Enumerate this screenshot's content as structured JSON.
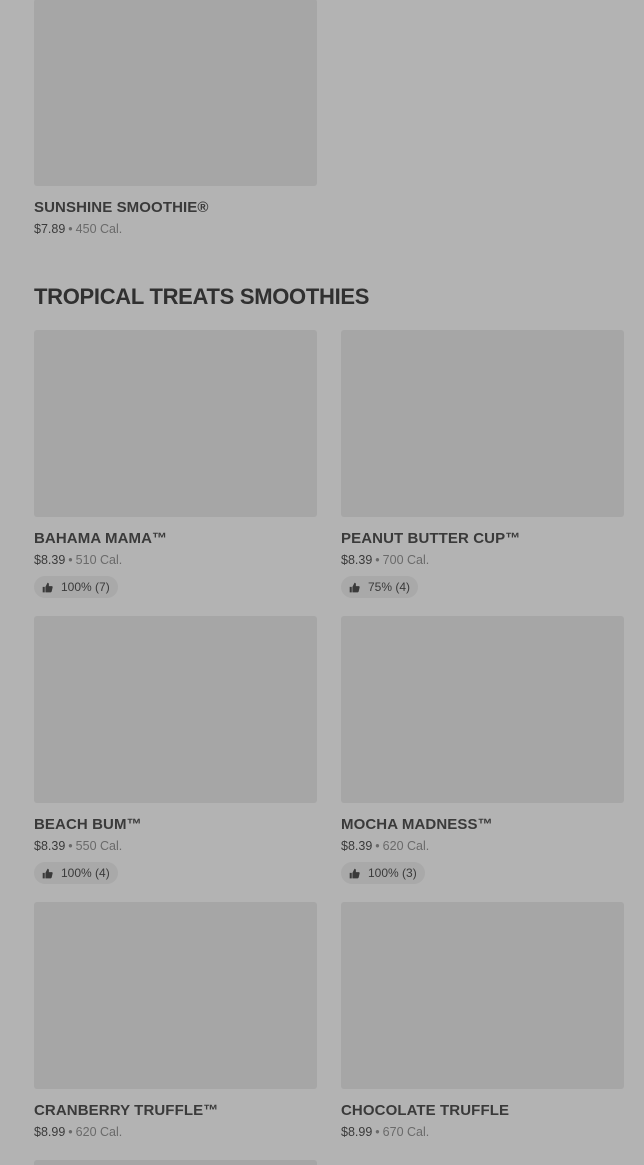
{
  "top_item": {
    "name": "SUNSHINE SMOOTHIE®",
    "price": "$7.89",
    "calories": "450 Cal."
  },
  "section": {
    "title": "TROPICAL TREATS SMOOTHIES"
  },
  "separator": "•",
  "items": [
    {
      "name": "BAHAMA MAMA™",
      "price": "$8.39",
      "calories": "510 Cal.",
      "rating": "100% (7)"
    },
    {
      "name": "PEANUT BUTTER CUP™",
      "price": "$8.39",
      "calories": "700 Cal.",
      "rating": "75% (4)"
    },
    {
      "name": "BEACH BUM™",
      "price": "$8.39",
      "calories": "550 Cal.",
      "rating": "100% (4)"
    },
    {
      "name": "MOCHA MADNESS™",
      "price": "$8.39",
      "calories": "620 Cal.",
      "rating": "100% (3)"
    },
    {
      "name": "CRANBERRY TRUFFLE™",
      "price": "$8.99",
      "calories": "620 Cal."
    },
    {
      "name": "CHOCOLATE TRUFFLE",
      "price": "$8.99",
      "calories": "670 Cal."
    }
  ],
  "icons": {
    "rating": "thumbs-up-icon"
  },
  "colors": {
    "background": "#b3b3b3",
    "image_placeholder": "#a6a6a6",
    "text": "#3a3a3a"
  }
}
